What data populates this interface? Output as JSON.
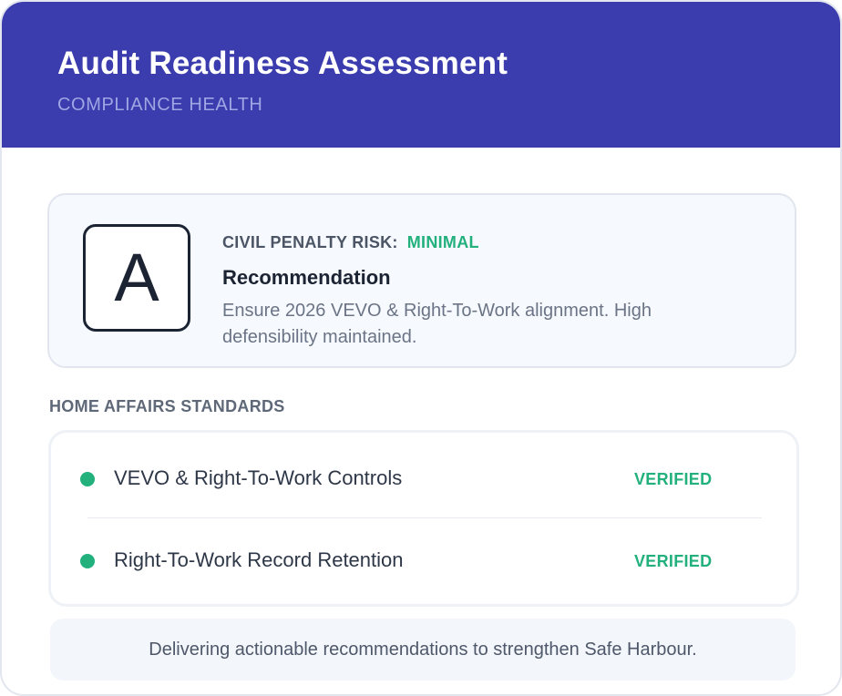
{
  "header": {
    "title": "Audit Readiness Assessment",
    "subtitle": "COMPLIANCE HEALTH"
  },
  "summary": {
    "grade": "A",
    "risk_label": "CIVIL PENALTY RISK:",
    "risk_value": "MINIMAL",
    "recommendation_title": "Recommendation",
    "recommendation_text": "Ensure 2026 VEVO & Right-To-Work alignment. High defensibility maintained."
  },
  "standards": {
    "section_title": "HOME AFFAIRS STANDARDS",
    "items": [
      {
        "label": "VEVO & Right-To-Work Controls",
        "status": "VERIFIED"
      },
      {
        "label": "Right-To-Work Record Retention",
        "status": "VERIFIED"
      }
    ]
  },
  "footer": {
    "note": "Delivering actionable recommendations to strengthen Safe Harbour."
  },
  "colors": {
    "header_bg": "#3b3cad",
    "status_green": "#22b07d",
    "text_dark": "#1c2433"
  }
}
